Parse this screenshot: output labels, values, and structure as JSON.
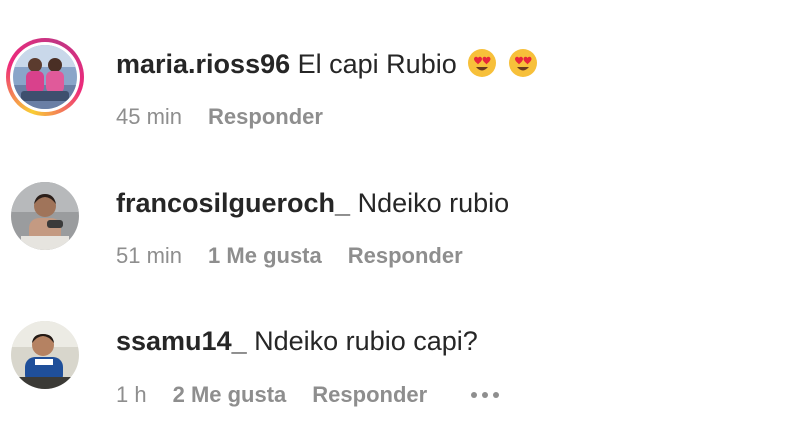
{
  "comments": [
    {
      "username": "maria.rioss96",
      "text": "El capi Rubio",
      "emoji": [
        "heart-eyes-emoji",
        "heart-eyes-emoji"
      ],
      "time": "45 min",
      "likes": "",
      "reply_label": "Responder",
      "has_story_ring": true
    },
    {
      "username": "francosilgueroch_",
      "text": "Ndeiko rubio",
      "time": "51 min",
      "likes": "1 Me gusta",
      "reply_label": "Responder",
      "has_story_ring": false
    },
    {
      "username": "ssamu14_",
      "text": "Ndeiko rubio capi?",
      "time": "1 h",
      "likes": "2 Me gusta",
      "reply_label": "Responder",
      "has_story_ring": false,
      "has_more_options": true
    }
  ],
  "colors": {
    "text_primary": "#262626",
    "text_secondary": "#8e8e8e",
    "story_ring_start": "#f9ce34",
    "story_ring_mid": "#ee2a7b",
    "story_ring_end": "#c13584"
  }
}
